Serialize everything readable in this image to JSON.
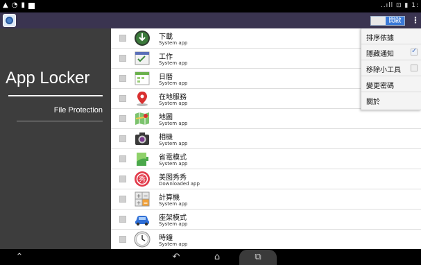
{
  "status_bar": {
    "left_icons": [
      "warning-icon",
      "wifi-icon",
      "sd-card-icon",
      "notification-icon"
    ],
    "right_text": "..ıll ⊡ ▮ 1:"
  },
  "action_bar": {
    "app_icon": "app-locker-icon",
    "toggle_label": "開啟",
    "overflow_icon": "overflow-menu-icon"
  },
  "sidebar": {
    "title": "App Locker",
    "subtitle": "File Protection"
  },
  "apps": [
    {
      "name": "下載",
      "type": "System app",
      "icon": "download-icon"
    },
    {
      "name": "工作",
      "type": "System app",
      "icon": "tasks-icon"
    },
    {
      "name": "日曆",
      "type": "System app",
      "icon": "calendar-icon"
    },
    {
      "name": "在地服務",
      "type": "System app",
      "icon": "location-icon"
    },
    {
      "name": "地圖",
      "type": "System app",
      "icon": "maps-icon"
    },
    {
      "name": "相機",
      "type": "System app",
      "icon": "camera-icon"
    },
    {
      "name": "省電模式",
      "type": "System app",
      "icon": "battery-saver-icon"
    },
    {
      "name": "美图秀秀",
      "type": "Downloaded app",
      "icon": "meitu-icon"
    },
    {
      "name": "計算機",
      "type": "System app",
      "icon": "calculator-icon"
    },
    {
      "name": "座架模式",
      "type": "System app",
      "icon": "car-dock-icon"
    },
    {
      "name": "時鐘",
      "type": "System app",
      "icon": "clock-icon"
    }
  ],
  "menu": {
    "items": [
      {
        "label": "排序依據",
        "checkbox": false
      },
      {
        "label": "隱藏通知",
        "checkbox": true,
        "checked": true
      },
      {
        "label": "移除小工具",
        "checkbox": true,
        "checked": false
      },
      {
        "label": "變更密碼",
        "checkbox": false
      },
      {
        "label": "關於",
        "checkbox": false
      }
    ]
  },
  "nav_bar": {
    "buttons": [
      "expand-icon",
      "back-icon",
      "home-icon",
      "recent-apps-icon"
    ]
  },
  "colors": {
    "action_bar": "#3a3450",
    "sidebar": "#3d3d3d",
    "toggle_on": "#3b7ad8",
    "check_accent": "#4a74c4"
  }
}
